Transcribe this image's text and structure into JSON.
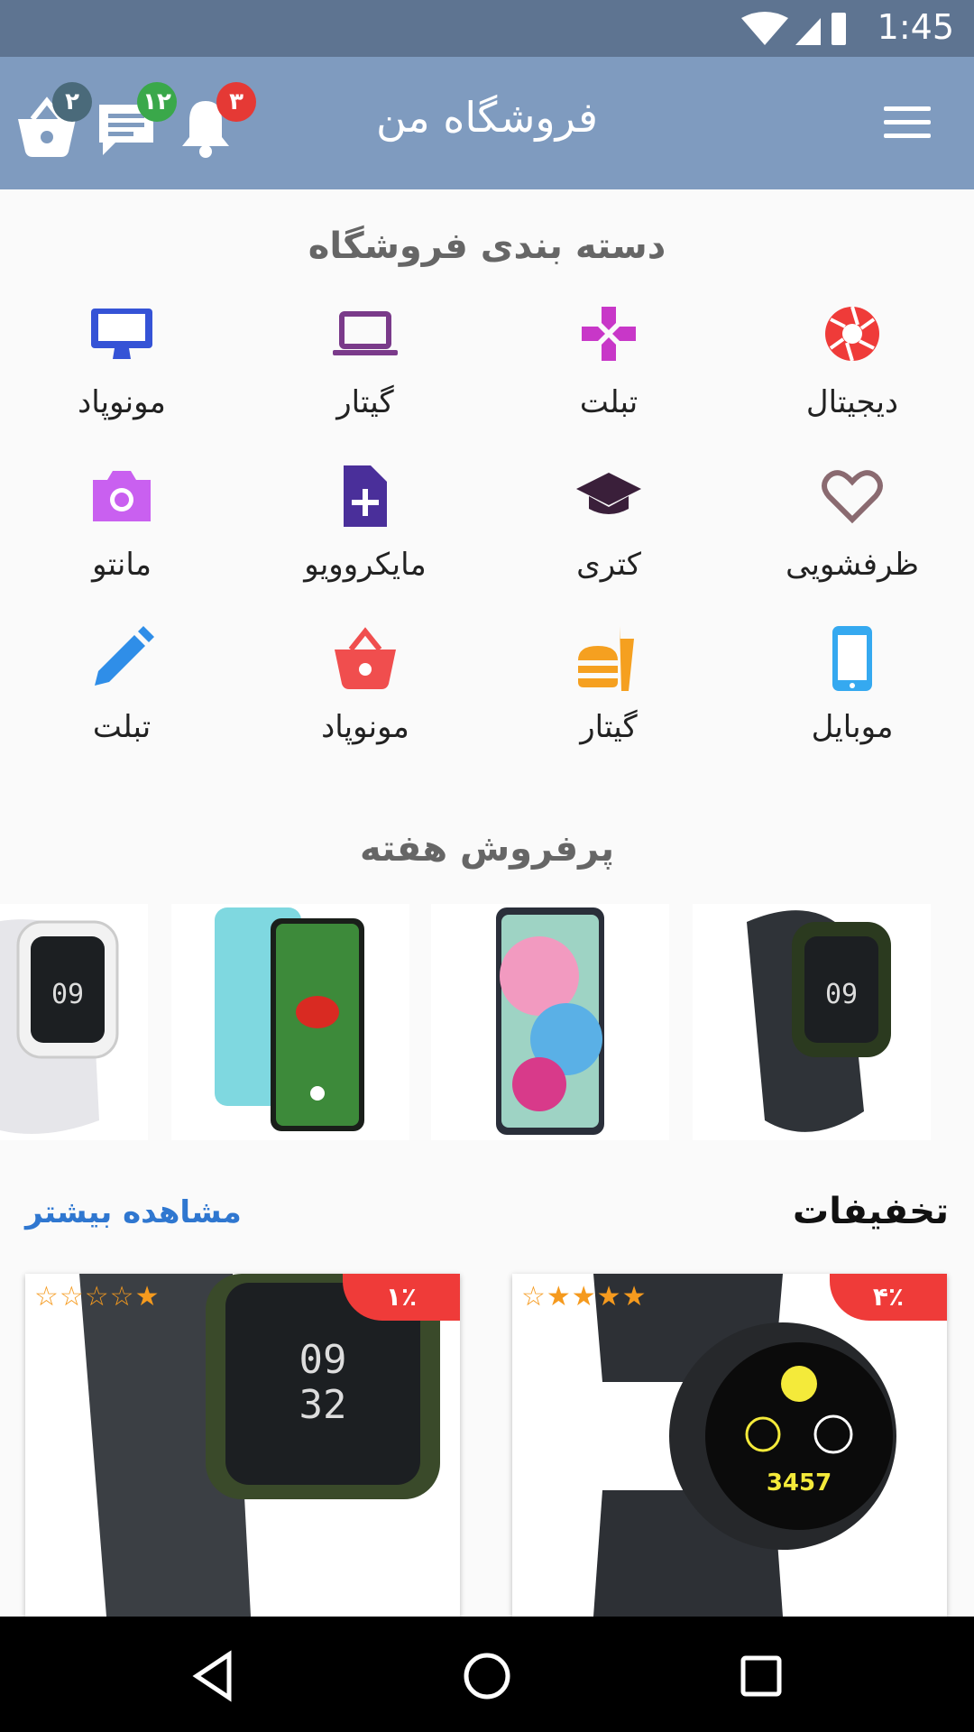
{
  "status": {
    "time": "1:45"
  },
  "appbar": {
    "title": "فروشگاه من",
    "cart_count": "۲",
    "messages_count": "۱۲",
    "notifications_count": "۳",
    "badge_colors": {
      "cart": "#4a6a7a",
      "messages": "#3aa84a",
      "notifications": "#e53935"
    }
  },
  "categories": {
    "title": "دسته بندی فروشگاه",
    "items": [
      {
        "label": "دیجیتال",
        "icon": "camera-aperture-icon",
        "color": "#ef3b39"
      },
      {
        "label": "تبلت",
        "icon": "gamepad-icon",
        "color": "#c837c8"
      },
      {
        "label": "گیتار",
        "icon": "laptop-icon",
        "color": "#7a3a8a"
      },
      {
        "label": "مونوپاد",
        "icon": "desktop-monitor-icon",
        "color": "#3553d6"
      },
      {
        "label": "ظرفشویی",
        "icon": "heart-outline-icon",
        "color": "#8a6a70"
      },
      {
        "label": "کتری",
        "icon": "graduation-cap-icon",
        "color": "#3a1f3a"
      },
      {
        "label": "مایکروویو",
        "icon": "add-document-icon",
        "color": "#4a2f9a"
      },
      {
        "label": "مانتو",
        "icon": "camera-icon",
        "color": "#c960f0"
      },
      {
        "label": "موبایل",
        "icon": "smartphone-icon",
        "color": "#35a9f0"
      },
      {
        "label": "گیتار",
        "icon": "fastfood-icon",
        "color": "#f5a020"
      },
      {
        "label": "مونوپاد",
        "icon": "shopping-basket-icon",
        "color": "#f04e4e"
      },
      {
        "label": "تبلت",
        "icon": "pencil-icon",
        "color": "#2f8ee8"
      }
    ]
  },
  "bestsellers": {
    "title": "پرفروش هفته",
    "items": [
      {
        "kind": "watch-dark"
      },
      {
        "kind": "phone-colorful"
      },
      {
        "kind": "phone-ladybug"
      },
      {
        "kind": "watch-white"
      }
    ]
  },
  "discounts": {
    "title": "تخفیفات",
    "see_more": "مشاهده بیشتر",
    "cards": [
      {
        "discount": "۴٪",
        "stars": "☆★★★★",
        "rating": 4,
        "kind": "round-watch"
      },
      {
        "discount": "۱٪",
        "stars": "☆☆☆☆★",
        "rating": 1,
        "kind": "square-watch"
      }
    ]
  }
}
